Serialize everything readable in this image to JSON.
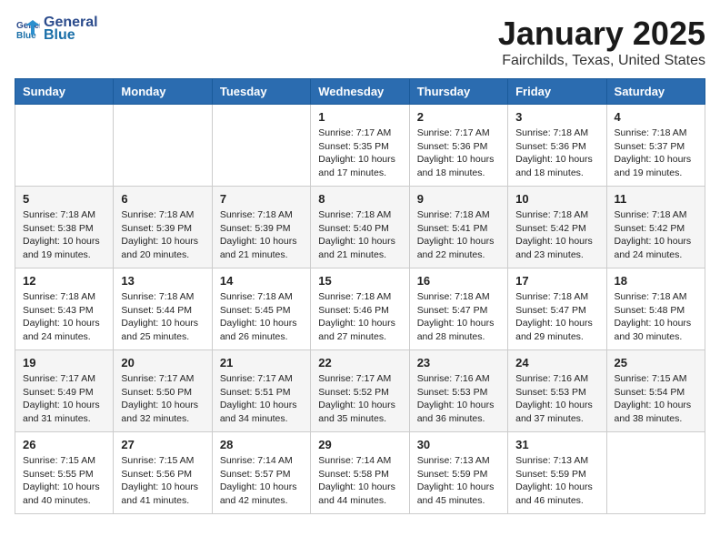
{
  "header": {
    "logo_line1": "General",
    "logo_line2": "Blue",
    "title": "January 2025",
    "subtitle": "Fairchilds, Texas, United States"
  },
  "days_of_week": [
    "Sunday",
    "Monday",
    "Tuesday",
    "Wednesday",
    "Thursday",
    "Friday",
    "Saturday"
  ],
  "weeks": [
    [
      {
        "day": "",
        "info": ""
      },
      {
        "day": "",
        "info": ""
      },
      {
        "day": "",
        "info": ""
      },
      {
        "day": "1",
        "info": "Sunrise: 7:17 AM\nSunset: 5:35 PM\nDaylight: 10 hours and 17 minutes."
      },
      {
        "day": "2",
        "info": "Sunrise: 7:17 AM\nSunset: 5:36 PM\nDaylight: 10 hours and 18 minutes."
      },
      {
        "day": "3",
        "info": "Sunrise: 7:18 AM\nSunset: 5:36 PM\nDaylight: 10 hours and 18 minutes."
      },
      {
        "day": "4",
        "info": "Sunrise: 7:18 AM\nSunset: 5:37 PM\nDaylight: 10 hours and 19 minutes."
      }
    ],
    [
      {
        "day": "5",
        "info": "Sunrise: 7:18 AM\nSunset: 5:38 PM\nDaylight: 10 hours and 19 minutes."
      },
      {
        "day": "6",
        "info": "Sunrise: 7:18 AM\nSunset: 5:39 PM\nDaylight: 10 hours and 20 minutes."
      },
      {
        "day": "7",
        "info": "Sunrise: 7:18 AM\nSunset: 5:39 PM\nDaylight: 10 hours and 21 minutes."
      },
      {
        "day": "8",
        "info": "Sunrise: 7:18 AM\nSunset: 5:40 PM\nDaylight: 10 hours and 21 minutes."
      },
      {
        "day": "9",
        "info": "Sunrise: 7:18 AM\nSunset: 5:41 PM\nDaylight: 10 hours and 22 minutes."
      },
      {
        "day": "10",
        "info": "Sunrise: 7:18 AM\nSunset: 5:42 PM\nDaylight: 10 hours and 23 minutes."
      },
      {
        "day": "11",
        "info": "Sunrise: 7:18 AM\nSunset: 5:42 PM\nDaylight: 10 hours and 24 minutes."
      }
    ],
    [
      {
        "day": "12",
        "info": "Sunrise: 7:18 AM\nSunset: 5:43 PM\nDaylight: 10 hours and 24 minutes."
      },
      {
        "day": "13",
        "info": "Sunrise: 7:18 AM\nSunset: 5:44 PM\nDaylight: 10 hours and 25 minutes."
      },
      {
        "day": "14",
        "info": "Sunrise: 7:18 AM\nSunset: 5:45 PM\nDaylight: 10 hours and 26 minutes."
      },
      {
        "day": "15",
        "info": "Sunrise: 7:18 AM\nSunset: 5:46 PM\nDaylight: 10 hours and 27 minutes."
      },
      {
        "day": "16",
        "info": "Sunrise: 7:18 AM\nSunset: 5:47 PM\nDaylight: 10 hours and 28 minutes."
      },
      {
        "day": "17",
        "info": "Sunrise: 7:18 AM\nSunset: 5:47 PM\nDaylight: 10 hours and 29 minutes."
      },
      {
        "day": "18",
        "info": "Sunrise: 7:18 AM\nSunset: 5:48 PM\nDaylight: 10 hours and 30 minutes."
      }
    ],
    [
      {
        "day": "19",
        "info": "Sunrise: 7:17 AM\nSunset: 5:49 PM\nDaylight: 10 hours and 31 minutes."
      },
      {
        "day": "20",
        "info": "Sunrise: 7:17 AM\nSunset: 5:50 PM\nDaylight: 10 hours and 32 minutes."
      },
      {
        "day": "21",
        "info": "Sunrise: 7:17 AM\nSunset: 5:51 PM\nDaylight: 10 hours and 34 minutes."
      },
      {
        "day": "22",
        "info": "Sunrise: 7:17 AM\nSunset: 5:52 PM\nDaylight: 10 hours and 35 minutes."
      },
      {
        "day": "23",
        "info": "Sunrise: 7:16 AM\nSunset: 5:53 PM\nDaylight: 10 hours and 36 minutes."
      },
      {
        "day": "24",
        "info": "Sunrise: 7:16 AM\nSunset: 5:53 PM\nDaylight: 10 hours and 37 minutes."
      },
      {
        "day": "25",
        "info": "Sunrise: 7:15 AM\nSunset: 5:54 PM\nDaylight: 10 hours and 38 minutes."
      }
    ],
    [
      {
        "day": "26",
        "info": "Sunrise: 7:15 AM\nSunset: 5:55 PM\nDaylight: 10 hours and 40 minutes."
      },
      {
        "day": "27",
        "info": "Sunrise: 7:15 AM\nSunset: 5:56 PM\nDaylight: 10 hours and 41 minutes."
      },
      {
        "day": "28",
        "info": "Sunrise: 7:14 AM\nSunset: 5:57 PM\nDaylight: 10 hours and 42 minutes."
      },
      {
        "day": "29",
        "info": "Sunrise: 7:14 AM\nSunset: 5:58 PM\nDaylight: 10 hours and 44 minutes."
      },
      {
        "day": "30",
        "info": "Sunrise: 7:13 AM\nSunset: 5:59 PM\nDaylight: 10 hours and 45 minutes."
      },
      {
        "day": "31",
        "info": "Sunrise: 7:13 AM\nSunset: 5:59 PM\nDaylight: 10 hours and 46 minutes."
      },
      {
        "day": "",
        "info": ""
      }
    ]
  ]
}
